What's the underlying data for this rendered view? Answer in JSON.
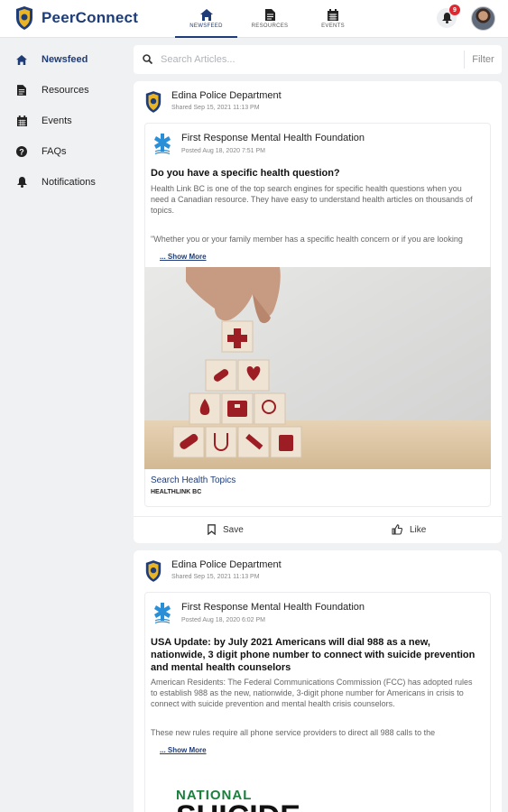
{
  "app": {
    "name": "PeerConnect"
  },
  "nav": {
    "tabs": [
      {
        "label": "NEWSFEED",
        "icon": "home-icon"
      },
      {
        "label": "RESOURCES",
        "icon": "document-icon"
      },
      {
        "label": "EVENTS",
        "icon": "calendar-icon"
      }
    ],
    "notification_count": "9"
  },
  "sidebar": {
    "items": [
      {
        "label": "Newsfeed",
        "icon": "home-icon"
      },
      {
        "label": "Resources",
        "icon": "document-icon"
      },
      {
        "label": "Events",
        "icon": "calendar-icon"
      },
      {
        "label": "FAQs",
        "icon": "question-icon"
      },
      {
        "label": "Notifications",
        "icon": "bell-icon"
      }
    ]
  },
  "search": {
    "placeholder": "Search Articles...",
    "filter_label": "Filter"
  },
  "posts": [
    {
      "author": "Edina Police Department",
      "shared_time": "Shared Sep 15, 2021 11:13 PM",
      "shared": {
        "org": "First Response Mental Health Foundation",
        "posted_time": "Posted Aug 18, 2020 7:51 PM",
        "title": "Do you have a specific health question?",
        "body_1": "Health Link BC is one of the top search engines for specific health questions when you need a Canadian resource. They have easy to understand health articles on thousands of topics.",
        "body_2": "\"Whether you or your family member has a specific health concern or if you are looking",
        "show_more": "... Show More",
        "link_title": "Search Health Topics",
        "link_source": "HEALTHLINK BC"
      },
      "save_label": "Save",
      "like_label": "Like"
    },
    {
      "author": "Edina Police Department",
      "shared_time": "Shared Sep 15, 2021 11:13 PM",
      "shared": {
        "org": "First Response Mental Health Foundation",
        "posted_time": "Posted Aug 18, 2020 6:02 PM",
        "title": "USA Update: by July 2021 Americans will dial 988 as a new, nationwide, 3 digit phone number to connect with suicide prevention and mental health counselors",
        "body_1": "American Residents: The Federal Communications Commission (FCC) has adopted rules to establish 988 as the new, nationwide, 3-digit phone number for Americans in crisis to connect with suicide prevention and mental health crisis counselors.",
        "body_2": "These new rules require all phone service providers to direct all 988 calls to the",
        "show_more": "... Show More",
        "image_text_1": "NATIONAL",
        "image_text_2": "SUICIDE"
      }
    }
  ],
  "colors": {
    "brand": "#1e3c78",
    "badge": "#e0262f",
    "background": "#f0f1f3"
  }
}
